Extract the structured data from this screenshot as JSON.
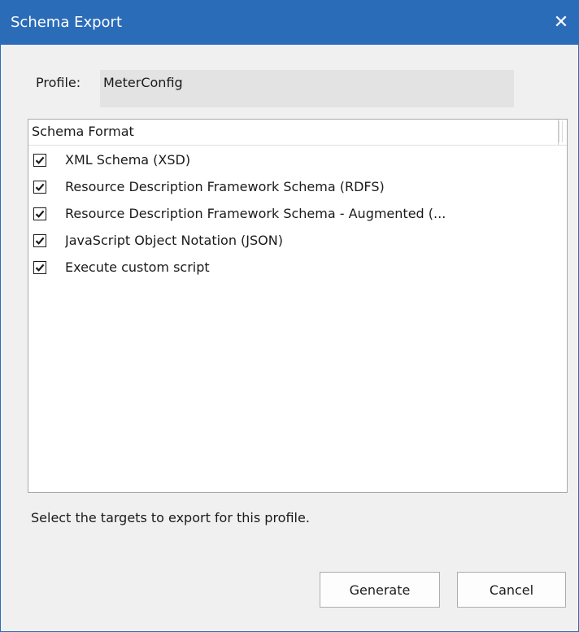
{
  "window": {
    "title": "Schema Export",
    "close_glyph": "✕",
    "accent_color": "#2b6cb8"
  },
  "profile": {
    "label": "Profile:",
    "value": "MeterConfig"
  },
  "list": {
    "column_header": "Schema Format",
    "items": [
      {
        "label": "XML Schema (XSD)",
        "checked": true
      },
      {
        "label": "Resource Description Framework Schema (RDFS)",
        "checked": true
      },
      {
        "label": "Resource Description Framework Schema - Augmented (...",
        "checked": true
      },
      {
        "label": "JavaScript Object Notation (JSON)",
        "checked": true
      },
      {
        "label": "Execute custom script",
        "checked": true
      }
    ]
  },
  "hint": "Select the targets to export for this profile.",
  "buttons": {
    "generate": "Generate",
    "cancel": "Cancel"
  },
  "icons": {
    "close": "close-icon",
    "check": "checkmark-icon"
  }
}
